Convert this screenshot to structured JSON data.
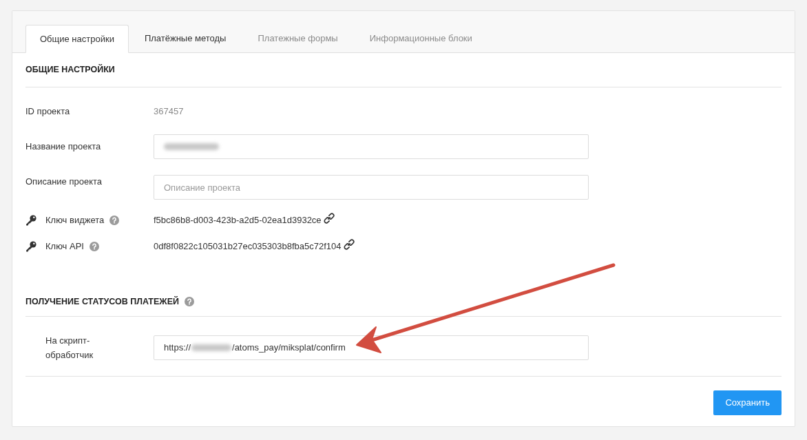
{
  "tabs": [
    {
      "label": "Общие настройки",
      "selected": true,
      "disabled": false
    },
    {
      "label": "Платёжные методы",
      "selected": false,
      "disabled": false
    },
    {
      "label": "Платежные формы",
      "selected": false,
      "disabled": true
    },
    {
      "label": "Информационные блоки",
      "selected": false,
      "disabled": true
    }
  ],
  "sections": [
    {
      "title": "ОБЩИЕ НАСТРОЙКИ",
      "help": false,
      "fields": [
        {
          "kind": "text",
          "label": "ID проекта",
          "value": "367457"
        },
        {
          "kind": "input",
          "label": "Название проекта",
          "blurred": true
        },
        {
          "kind": "input",
          "label": "Описание проекта",
          "placeholder": "Описание проекта"
        },
        {
          "kind": "key",
          "label": "Ключ виджета",
          "help": true,
          "value": "f5bc86b8-d003-423b-a2d5-02ea1d3932ce"
        },
        {
          "kind": "key",
          "label": "Ключ API",
          "help": true,
          "value": "0df8f0822c105031b27ec035303b8fba5c72f104"
        }
      ]
    },
    {
      "title": "ПОЛУЧЕНИЕ СТАТУСОВ ПЛАТЕЖЕЙ",
      "help": true,
      "fields": [
        {
          "kind": "url",
          "label": "На скрипт-обработчик",
          "prefix": "https://",
          "blurred": true,
          "suffix": "/atoms_pay/miksplat/confirm"
        }
      ]
    }
  ],
  "save_button": {
    "label": "Сохранить"
  },
  "annotation": {
    "kind": "arrow"
  }
}
